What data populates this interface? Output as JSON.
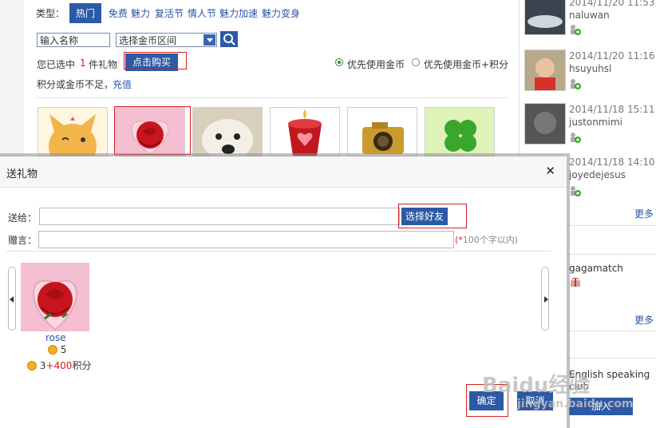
{
  "background": {
    "category_label": "类型：",
    "categories": [
      "热门",
      "免费",
      "魅力",
      "复活节",
      "情人节",
      "魅力加速",
      "魅力变身"
    ],
    "name_input_value": "输入名称",
    "coin_range_value": "选择金币区间",
    "selected_prefix": "您已选中",
    "selected_count": "1",
    "selected_suffix": "件礼物",
    "buy_button": "点击购买",
    "radio_gold_first": "优先使用金币",
    "radio_gold_points_first": "优先使用金币+积分",
    "insufficient_text": "积分或金币不足，",
    "recharge_link": "充值"
  },
  "feed": {
    "items": [
      {
        "date": "2014/11/20 11:53",
        "user": "naluwan"
      },
      {
        "date": "2014/11/20 11:16",
        "user": "hsuyuhsl"
      },
      {
        "date": "2014/11/18 15:11",
        "user": "justonmimi"
      },
      {
        "date": "2014/11/18 14:10",
        "user": "joyedejesus"
      }
    ],
    "more_label": "更多",
    "gift_user": "gagamatch",
    "more_label_2": "更多",
    "group_text": "English speaking club",
    "join_button": "加入"
  },
  "modal": {
    "title": "送礼物",
    "close_icon": "close-icon",
    "to_label": "送给：",
    "to_value": "",
    "select_friend_button": "选择好友",
    "message_label": "赠言：",
    "message_value": "",
    "hint_star": "(*",
    "hint_text": "100个字以内)",
    "gift": {
      "name": "rose",
      "coin_price": "5",
      "combo_price_coins": "3",
      "combo_plus": "+",
      "combo_points": "400",
      "combo_points_unit": "积分"
    },
    "confirm_button": "确定",
    "cancel_button": "取消"
  },
  "colors": {
    "accent": "#2d5aa5",
    "highlight": "#d42020",
    "link": "#2a55a8",
    "points_red": "#d42020"
  },
  "watermark": {
    "brand": "Baidu经验",
    "url": "jingyan.baidu.com"
  }
}
